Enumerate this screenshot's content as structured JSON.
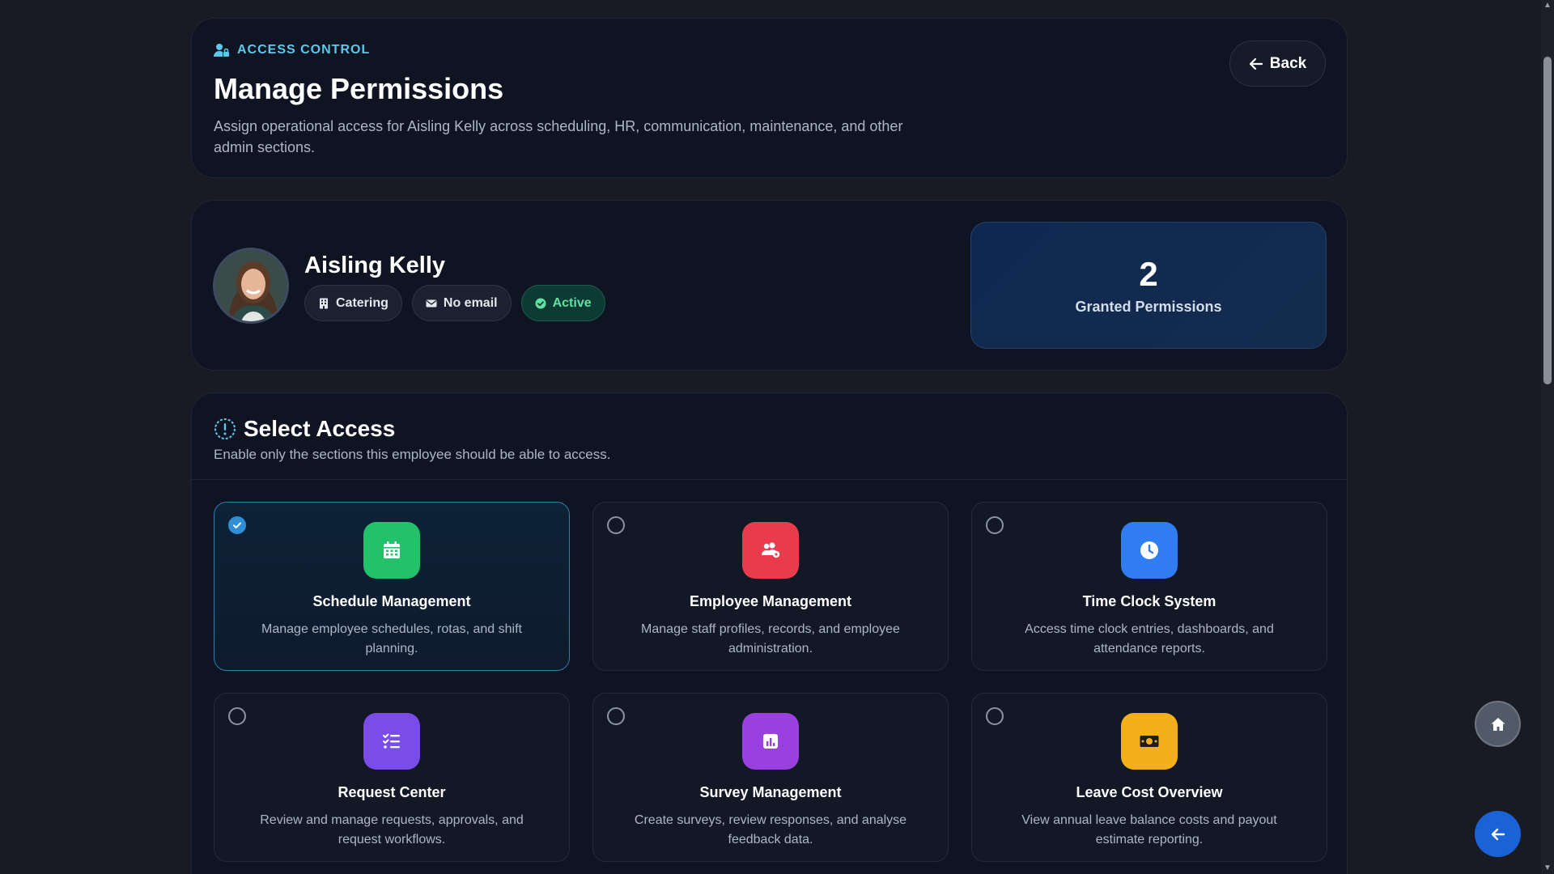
{
  "header": {
    "eyebrow": "ACCESS CONTROL",
    "title": "Manage Permissions",
    "subtitle": "Assign operational access for Aisling Kelly across scheduling, HR, communication, maintenance, and other admin sections.",
    "back_label": "Back"
  },
  "profile": {
    "name": "Aisling Kelly",
    "department": "Catering",
    "email": "No email",
    "status": "Active",
    "granted_count": "2",
    "granted_label": "Granted Permissions"
  },
  "access": {
    "title": "Select Access",
    "subtitle": "Enable only the sections this employee should be able to access.",
    "items": [
      {
        "title": "Schedule Management",
        "description": "Manage employee schedules, rotas, and shift planning.",
        "selected": true,
        "icon": "calendar-icon",
        "color": "#22c16a"
      },
      {
        "title": "Employee Management",
        "description": "Manage staff profiles, records, and employee administration.",
        "selected": false,
        "icon": "users-cog-icon",
        "color": "#ea3b4d"
      },
      {
        "title": "Time Clock System",
        "description": "Access time clock entries, dashboards, and attendance reports.",
        "selected": false,
        "icon": "clock-icon",
        "color": "#2f7df0"
      },
      {
        "title": "Request Center",
        "description": "Review and manage requests, approvals, and request workflows.",
        "selected": false,
        "icon": "list-check-icon",
        "color": "#7a4ce8"
      },
      {
        "title": "Survey Management",
        "description": "Create surveys, review responses, and analyse feedback data.",
        "selected": false,
        "icon": "chart-bar-icon",
        "color": "#9a3fe0"
      },
      {
        "title": "Leave Cost Overview",
        "description": "View annual leave balance costs and payout estimate reporting.",
        "selected": false,
        "icon": "money-bill-icon",
        "color": "#f3b01a"
      }
    ]
  },
  "colors": {
    "accent": "#5cc8ea",
    "active_green": "#5ee2a1",
    "fab_blue": "#1a63d6"
  }
}
